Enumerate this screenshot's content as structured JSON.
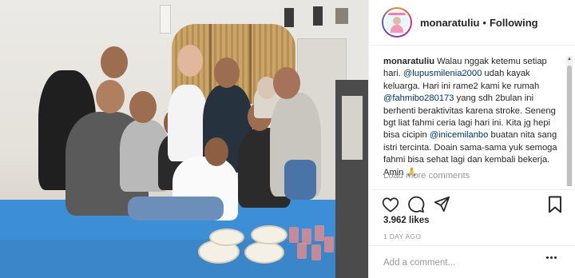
{
  "post": {
    "username": "monaratuliu",
    "separator": "•",
    "follow_status": "Following",
    "caption": {
      "segments": [
        {
          "type": "user",
          "text": "monaratuliu"
        },
        {
          "type": "text",
          "text": " Walau nggak ketemu setiap hari. "
        },
        {
          "type": "mention",
          "text": "@lupusmilenia2000"
        },
        {
          "type": "text",
          "text": " udah kayak keluarga. Hari ini rame2 kami ke rumah "
        },
        {
          "type": "mention",
          "text": "@fahmibo280173"
        },
        {
          "type": "text",
          "text": " yang sdh 2bulan ini berhenti beraktivitas karena stroke. Seneng bgt liat fahmi ceria lagi hari ini. Kita jg hepi bisa cicipin "
        },
        {
          "type": "mention",
          "text": "@inicemilanbo"
        },
        {
          "type": "text",
          "text": " buatan nita sang istri tercinta. Doain sama-sama yuk semoga fahmi bisa sehat lagi dan kembali bekerja. Amin 🙏"
        }
      ]
    },
    "load_more": "Load more comments",
    "likes": "3.962 likes",
    "time_ago": "1 DAY AGO",
    "comment_placeholder": "Add a comment...",
    "icons": {
      "like": "heart-icon",
      "comment": "comment-icon",
      "share": "share-icon",
      "save": "bookmark-icon",
      "more": "more-options-icon"
    },
    "colors": {
      "text": "#262626",
      "muted": "#999999",
      "mention": "#003569",
      "border": "#efefef"
    }
  }
}
